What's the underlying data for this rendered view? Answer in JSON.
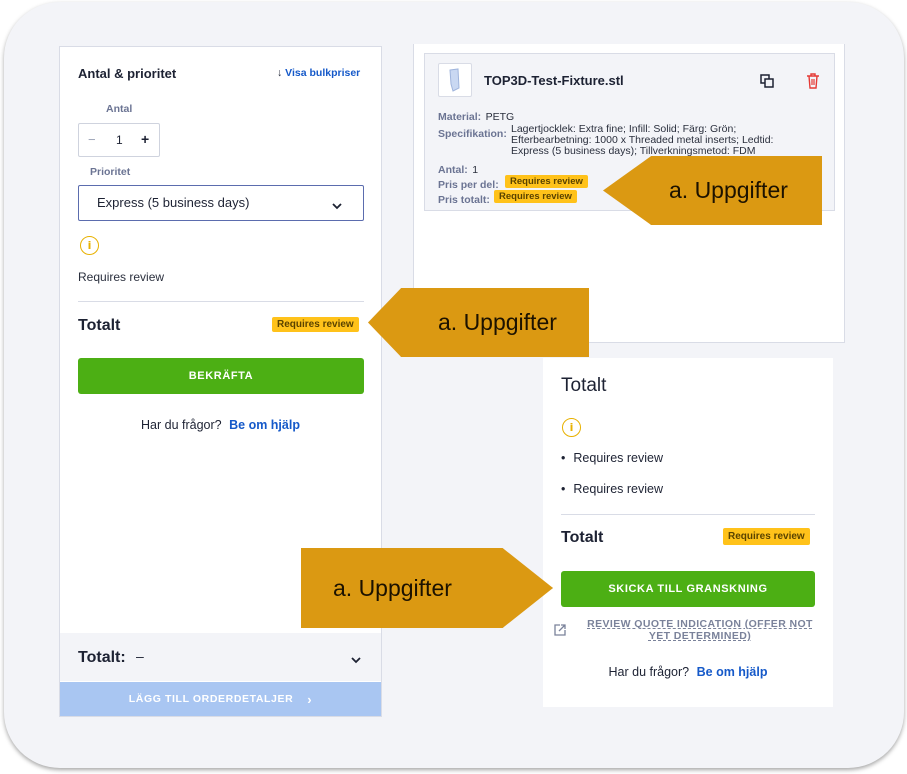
{
  "left": {
    "heading": "Antal & prioritet",
    "bulk_link": "Visa bulkpriser",
    "qty_label": "Antal",
    "qty_minus": "−",
    "qty_value": "1",
    "qty_plus": "+",
    "priority_label": "Prioritet",
    "priority_value": "Express (5 business days)",
    "review_text": "Requires review",
    "total_label": "Totalt",
    "total_badge": "Requires review",
    "confirm_button": "BEKRÄFTA",
    "help_question": "Har du frågor?",
    "help_link": "Be om hjälp",
    "footer_total_label": "Totalt:",
    "footer_total_value": "–",
    "add_button": "LÄGG TILL ORDERDETALJER"
  },
  "item": {
    "filename": "TOP3D-Test-Fixture.stl",
    "material_label": "Material:",
    "material_value": "PETG",
    "spec_label": "Specifikation:",
    "spec_line1": "Lagertjocklek: Extra fine; Infill: Solid; Färg: Grön;",
    "spec_line2": "Efterbearbetning: 1000 x Threaded metal inserts; Ledtid:",
    "spec_line3": "Express (5 business days); Tillverkningsmetod: FDM",
    "qty_label": "Antal:",
    "qty_value": "1",
    "unit_price_label": "Pris per del:",
    "unit_price_badge": "Requires review",
    "total_price_label": "Pris totalt:",
    "total_price_badge": "Requires review"
  },
  "summary": {
    "heading": "Totalt",
    "bullets": [
      "Requires review",
      "Requires review"
    ],
    "total_label": "Totalt",
    "total_badge": "Requires review",
    "submit_button": "SKICKA TILL GRANSKNING",
    "review_link_line1": "REVIEW QUOTE INDICATION (OFFER NOT",
    "review_link_line2": "YET DETERMINED)",
    "help_question": "Har du frågor?",
    "help_link": "Be om hjälp"
  },
  "callouts": {
    "top": "a. Uppgifter",
    "middle": "a. Uppgifter",
    "bottom": "a. Uppgifter"
  },
  "colors": {
    "accent_green": "#4caf14",
    "badge_yellow": "#ffc21a",
    "link_blue": "#1559c9",
    "callout_orange": "#db9912",
    "disabled_blue": "#a9c6f2",
    "delete_red": "#e53935"
  }
}
